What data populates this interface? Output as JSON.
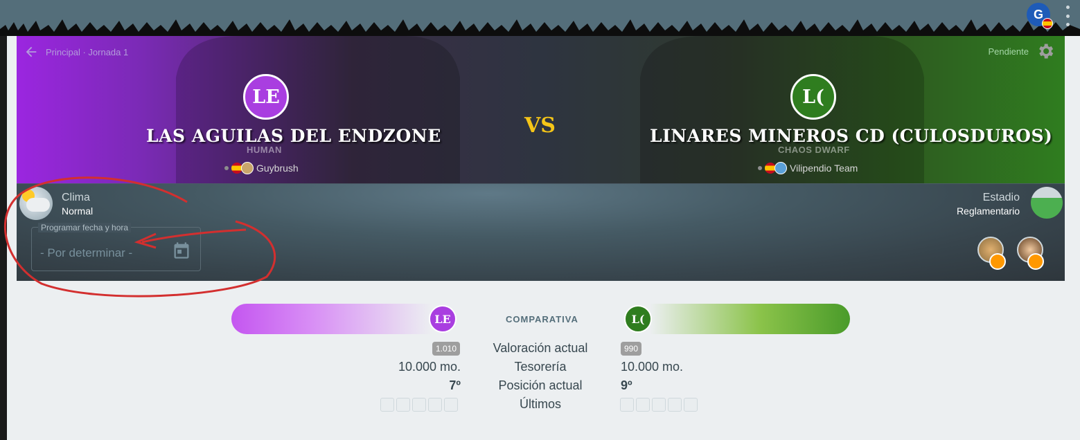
{
  "topbar": {
    "user_initial": "G"
  },
  "header": {
    "breadcrumb": "Principal · Jornada 1",
    "status": "Pendiente",
    "vs": "VS"
  },
  "home": {
    "initials": "LE",
    "name": "Las Aguilas Del Endzone",
    "race": "HUMAN",
    "coach": "Guybrush",
    "color": "#a93ee0"
  },
  "away": {
    "initials": "L(",
    "name": "Linares Mineros CD (CulosDuros)",
    "race": "CHAOS DWARF",
    "coach": "Vilipendio Team",
    "color": "#2f7d1f"
  },
  "info": {
    "weather_label": "Clima",
    "weather_value": "Normal",
    "stadium_label": "Estadio",
    "stadium_value": "Reglamentario",
    "schedule_label": "Programar fecha y hora",
    "schedule_placeholder": "- Por determinar -"
  },
  "comparison": {
    "title": "COMPARATIVA",
    "rows": [
      {
        "label": "Valoración actual",
        "home": "1.010",
        "away": "990"
      },
      {
        "label": "Tesorería",
        "home": "10.000 mo.",
        "away": "10.000 mo."
      },
      {
        "label": "Posición actual",
        "home": "7º",
        "away": "9º"
      },
      {
        "label": "Últimos",
        "home": "",
        "away": ""
      }
    ]
  },
  "colors": {
    "accent_pending": "#a5d6a7",
    "vs": "#f5c518",
    "clock": "#ff9800"
  }
}
